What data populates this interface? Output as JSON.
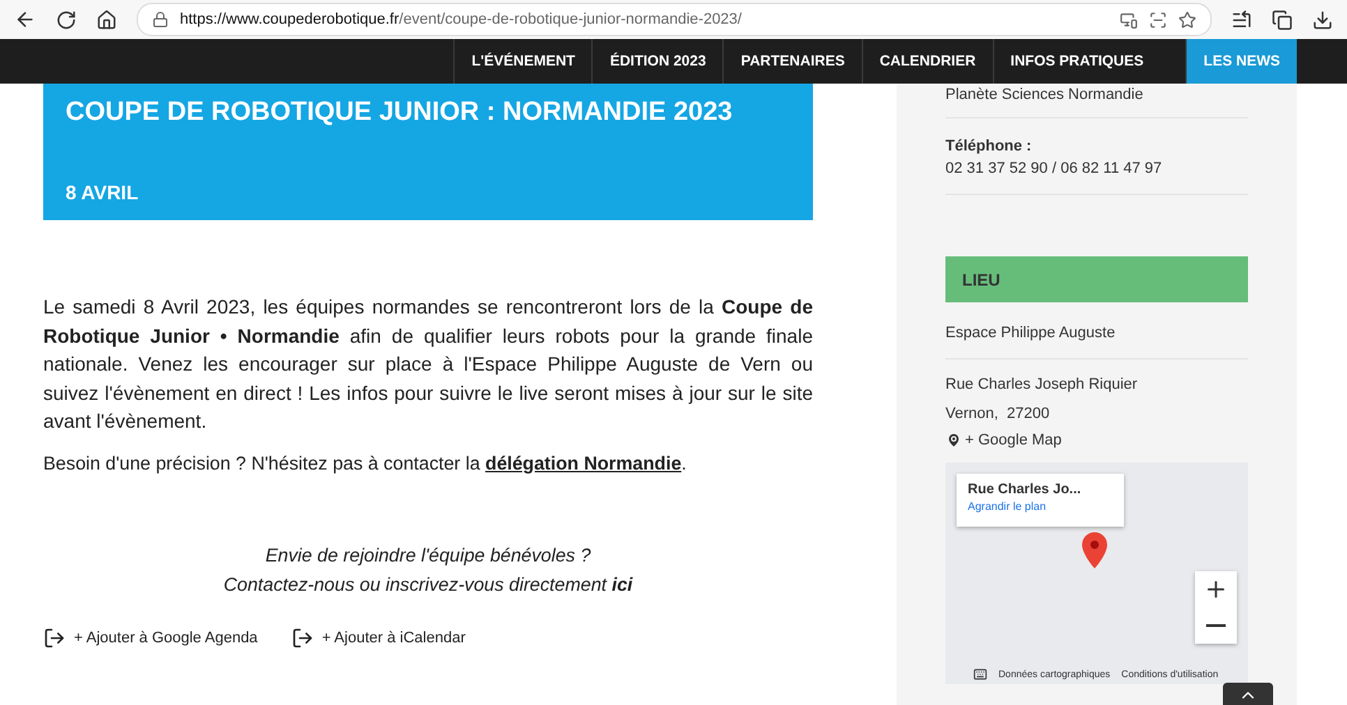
{
  "browser": {
    "url_host": "https://www.coupederobotique.fr",
    "url_path": "/event/coupe-de-robotique-junior-normandie-2023/"
  },
  "nav": [
    {
      "label": "L'ÉVÉNEMENT",
      "selected": false
    },
    {
      "label": "ÉDITION 2023",
      "selected": false
    },
    {
      "label": "PARTENAIRES",
      "selected": false
    },
    {
      "label": "CALENDRIER",
      "selected": false
    },
    {
      "label": "INFOS PRATIQUES",
      "selected": false
    },
    {
      "label": "LES NEWS",
      "selected": true
    }
  ],
  "banner": {
    "title": "COUPE DE ROBOTIQUE JUNIOR : NORMANDIE 2023",
    "date": "8 AVRIL"
  },
  "intro": "Le samedi 8 Avril 2023, les équipes normandes se rencontreront lors de la **Coupe de Robotique Junior • Normandie** afin de qualifier leurs robots pour la grande finale nationale. Venez les encourager sur place à l'Espace Philippe Auguste de Vern ou suivez l'évènement en direct ! Les infos pour suivre le live seront mises à jour sur le site avant l'évènement.",
  "contact": {
    "text": "Besoin d'une précision ? N'hésitez pas à contacter la",
    "link": "délégation Normandie",
    "end": "."
  },
  "volunteer": {
    "line1": "Envie de rejoindre l'équipe bénévoles ?",
    "line2": "Contactez-nous ou inscrivez-vous directement",
    "link": "ici"
  },
  "calendar_links": [
    "+ Ajouter à Google Agenda",
    "+ Ajouter à iCalendar"
  ],
  "sidebar": {
    "organizer": "Planète Sciences Normandie",
    "phone_label": "Téléphone :",
    "phone": "02 31 37 52 90 / 06 82 11 47 97",
    "venue_heading": "LIEU",
    "venue": "Espace Philippe Auguste",
    "street": "Rue Charles Joseph Riquier",
    "city": "Vernon,  27200",
    "map_link": "+ Google Map",
    "map": {
      "place": "Rue Charles Jo...",
      "enlarge": "Agrandir le plan",
      "data": "Données cartographiques",
      "terms": "Conditions d'utilisation"
    }
  }
}
